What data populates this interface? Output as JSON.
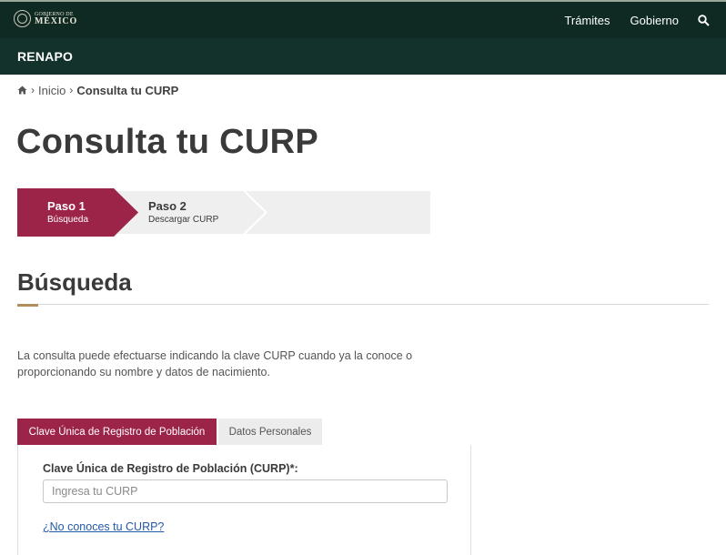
{
  "header": {
    "logo_small": "GOBIERNO DE",
    "logo_big": "MÉXICO",
    "nav": [
      "Trámites",
      "Gobierno"
    ],
    "search_icon": "search-icon"
  },
  "subheader": {
    "title": "RENAPO"
  },
  "breadcrumb": {
    "home_icon": "home-icon",
    "items": [
      "Inicio",
      "Consulta tu CURP"
    ]
  },
  "page": {
    "title": "Consulta tu CURP"
  },
  "steps": [
    {
      "number": "Paso 1",
      "label": "Búsqueda",
      "active": true
    },
    {
      "number": "Paso 2",
      "label": "Descargar CURP",
      "active": false
    }
  ],
  "section": {
    "title": "Búsqueda",
    "intro": "La consulta puede efectuarse indicando la clave CURP cuando ya la conoce o proporcionando su nombre y datos de nacimiento."
  },
  "tabs": [
    {
      "label": "Clave Única de Registro de Población",
      "active": true
    },
    {
      "label": "Datos Personales",
      "active": false
    }
  ],
  "form": {
    "curp_label": "Clave Única de Registro de Población (CURP)*:",
    "curp_value": "",
    "curp_placeholder": "Ingresa tu CURP",
    "help_link": "¿No conoces tu CURP?"
  },
  "colors": {
    "header_bg": "#0f2a22",
    "subheader_bg": "#13322b",
    "accent": "#9d2449",
    "gold": "#b38e5d",
    "link": "#2359a8"
  }
}
